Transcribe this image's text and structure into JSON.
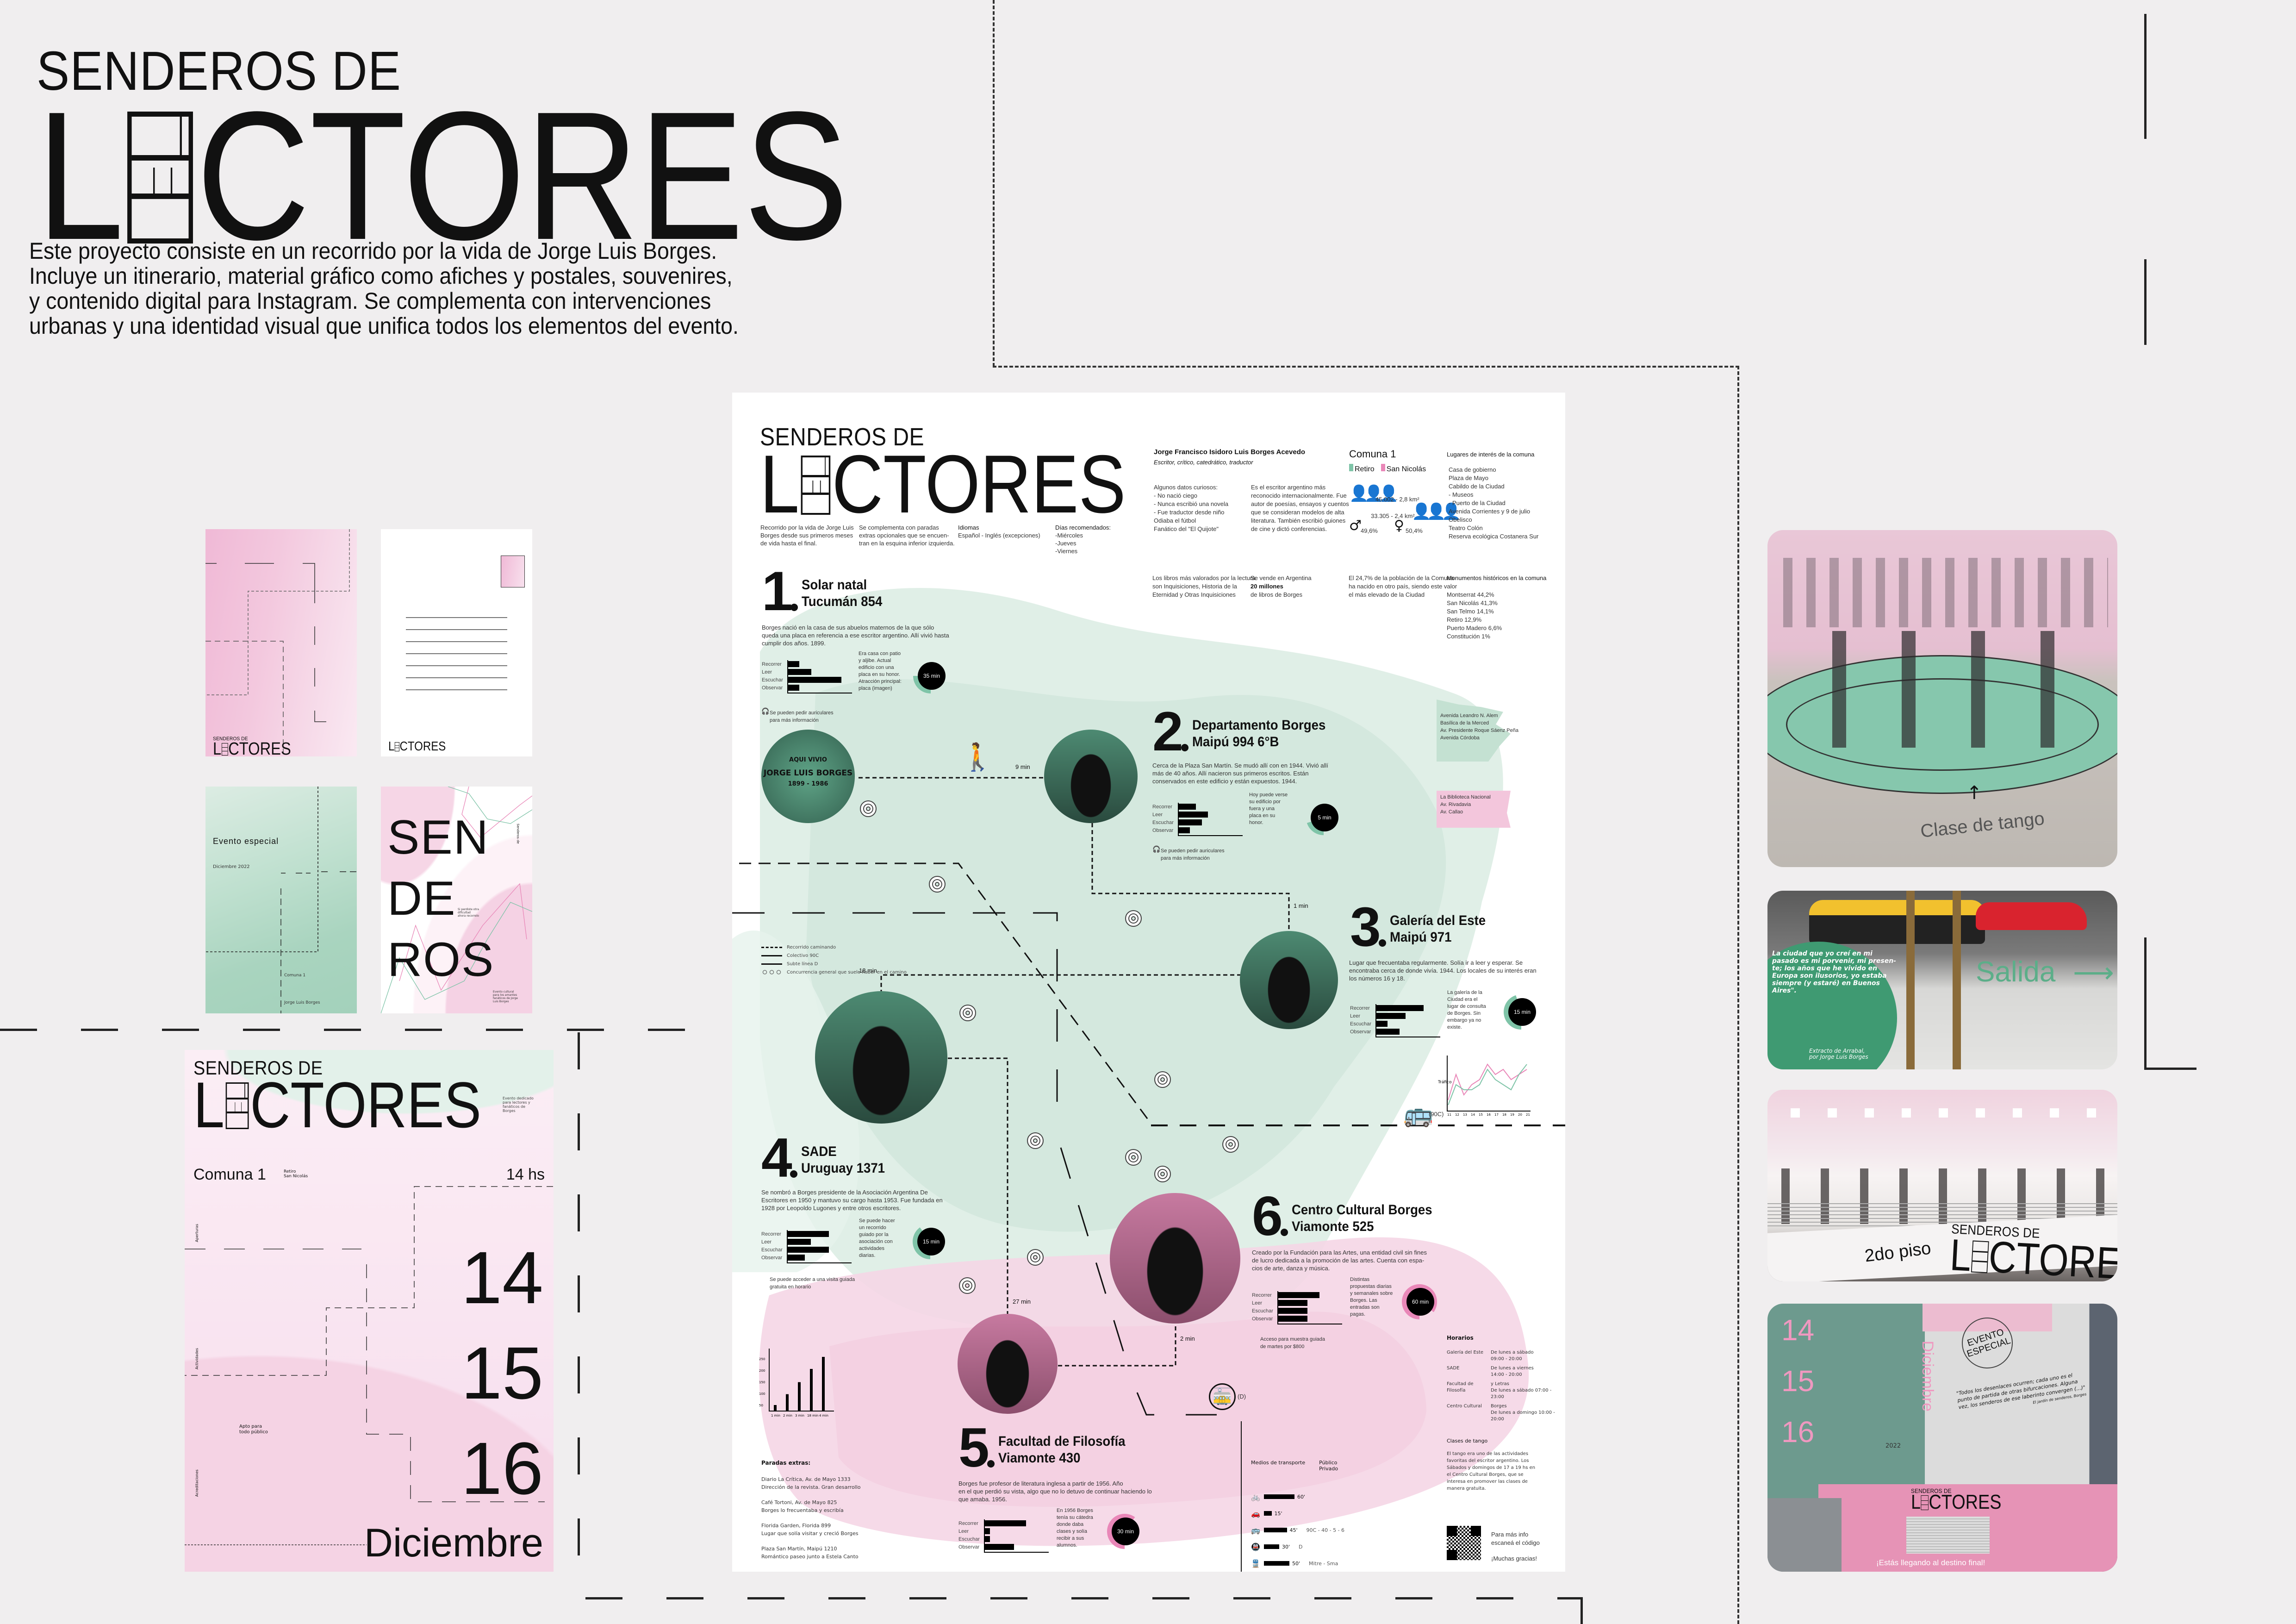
{
  "logo": {
    "prefix": "SENDEROS DE",
    "first_letter": "L",
    "rest": "CTORES"
  },
  "board": {
    "description": [
      "Este proyecto consiste en un recorrido por la vida de Jorge Luis Borges.",
      "Incluye un itinerario, material gráfico como afiches y postales, souvenires,",
      "y contenido digital para Instagram. Se complementa con intervenciones",
      "urbanas y una identidad visual que unifica todos los elementos del evento."
    ]
  },
  "colors": {
    "green": "#7fc4a8",
    "pink": "#e987b8",
    "light_green": "#d6eadf",
    "light_pink": "#f5d6e6",
    "background": "#f0eeef"
  },
  "poster": {
    "intro": [
      [
        "Recorrido por la vida de Jorge Luis",
        "Borges desde sus primeros meses",
        "de vida hasta el final."
      ],
      [
        "Se complementa con paradas",
        "extras opcionales que se encuen-",
        "tran en la esquina inferior izquierda."
      ],
      [
        "Idiomas",
        "Español - Inglés (excepciones)"
      ],
      [
        "Días recomendados:",
        "-Miércoles",
        "-Jueves",
        "-Viernes"
      ]
    ],
    "bio": {
      "name": "Jorge Francisco Isidoro Luis Borges Acevedo",
      "role": "Escritor, crítico, catedrático, traductor",
      "facts": [
        "Algunos datos curiosos:",
        "- No nació ciego",
        "- Nunca escribió una novela",
        "- Fue traductor desde niño",
        "  Odiaba el fútbol",
        "  Fanático del \"El Quijote\""
      ],
      "facts2": [
        "Es el escritor argentino más",
        "reconocido internacionalmente. Fue",
        "autor de poesías, ensayos y cuentos",
        "que se consideran modelos de alta",
        "literatura. También escribió guiones",
        "de cine y dictó conferencias."
      ]
    },
    "comuna": {
      "title": "Comuna 1",
      "areas": [
        {
          "name": "Retiro",
          "color": "#7fc4a8"
        },
        {
          "name": "San Nicolás",
          "color": "#e987b8"
        }
      ],
      "pink_stat": "45.002 - 2,8 km²",
      "green_stat": "33.305 - 2,4 km²",
      "male": "49,6%",
      "female": "50,4%"
    },
    "lugares": {
      "title": "Lugares de interés de la comuna",
      "items": [
        "Casa de gobierno",
        "Plaza de Mayo",
        "Cabildo de la Ciudad",
        "- Museos",
        "- Puerto de la Ciudad",
        "Avenida Corrientes y 9 de julio",
        "Obelisco",
        "Teatro Colón",
        "Reserva ecológica Costanera Sur"
      ]
    },
    "stats": [
      [
        "Los libros más valorados por la lectura",
        "son Inquisiciones, Historia de la",
        "Eternidad y Otras Inquisiciones"
      ],
      [
        "Se vende en Argentina",
        "20 millones",
        "de libros de Borges"
      ],
      [
        "El 24,7% de la población de la Comuna",
        "ha nacido en otro país, siendo este valor",
        "el más elevado de la Ciudad"
      ]
    ],
    "monumentos": {
      "title": "Monumentos históricos en la comuna",
      "items": [
        "Montserrat 44,2%",
        "San Nicolás 41,3%",
        "San Telmo 14,1%",
        "Retiro 12,9%",
        "Puerto Madero 6,6%",
        "Constitución 1%"
      ]
    },
    "bar_labels": [
      "Recorrer",
      "Leer",
      "Escuchar",
      "Observar"
    ],
    "stops": [
      {
        "number": "1",
        "name": "Solar natal",
        "address": "Tucumán 854",
        "desc": [
          "Borges nació en la casa de sus abuelos maternos de la que sólo",
          "queda una placa en referencia a ese escritor argentino. Allí vivió hasta",
          "cumplir dos años. 1899."
        ],
        "bars": [
          2,
          4,
          9,
          2
        ],
        "side": [
          "Era casa con patio",
          "y aljibe. Actual",
          "edificio con una",
          "placa en su honor.",
          "Atracción principal:",
          "placa (imagen)"
        ],
        "gauge": "35 min",
        "gauge_fraction": 0.25,
        "tone": "green",
        "note": [
          "Se pueden pedir auriculares",
          "para más información"
        ],
        "time": "",
        "plaque": [
          "AQUI VIVIO",
          "JORGE LUIS BORGES",
          "1899 - 1986"
        ]
      },
      {
        "number": "2",
        "name": "Departamento Borges",
        "address": "Maipú 994 6°B",
        "desc": [
          "Cerca de la Plaza San Martín. Se mudó allí con en 1944. Vivió allí",
          "más de 40 años. Allí nacieron sus primeros escritos. Están",
          "conservados en este edificio y están expuestos. 1944."
        ],
        "bars": [
          3,
          5,
          4,
          2
        ],
        "side": [
          "Hoy puede verse",
          "su edificio por",
          "fuera y una",
          "placa en su",
          "honor."
        ],
        "gauge": "5 min",
        "gauge_fraction": 0.2,
        "tone": "green",
        "note": [
          "Se pueden pedir auriculares",
          "para más información"
        ],
        "time": "9 min"
      },
      {
        "number": "3",
        "name": "Galería del Este",
        "address": "Maipú 971",
        "desc": [
          "Lugar que frecuentaba regularmente. Solía ir a leer y esperar. Se",
          "encontraba cerca de donde vivía. 1944. Los locales de su interés eran",
          "los números 16 y 18."
        ],
        "bars": [
          8,
          5,
          2,
          4
        ],
        "side": [
          "La galería de la",
          "Ciudad era el",
          "lugar de consulta",
          "de Borges. Sin",
          "embargo ya no",
          "existe."
        ],
        "gauge": "15 min",
        "gauge_fraction": 0.45,
        "tone": "green",
        "time": "1 min"
      },
      {
        "number": "4",
        "name": "SADE",
        "address": "Uruguay 1371",
        "desc": [
          "Se nombró a Borges presidente de la Asociación Argentina De",
          "Escritores en 1950 y mantuvo su cargo hasta 1953. Fue fundada en",
          "1928 por Leopoldo Lugones y entre otros escritores."
        ],
        "bars": [
          7,
          4,
          7,
          3
        ],
        "side": [
          "Se puede hacer",
          "un recorrido",
          "guiado por la",
          "asociación con",
          "actividades",
          "diarias."
        ],
        "gauge": "15 min",
        "gauge_fraction": 0.4,
        "tone": "green",
        "note": [
          "Se puede acceder a una visita guiada",
          "gratuita en horario"
        ],
        "time": "18 min"
      },
      {
        "number": "5",
        "name": "Facultad de Filosofía",
        "address": "Viamonte 430",
        "desc": [
          "Borges fue profesor de literatura inglesa a partir de 1956. Año",
          "en el que perdió su vista, algo que no lo detuvo de continuar haciendo lo",
          "que amaba. 1956."
        ],
        "bars": [
          7,
          1,
          1,
          5
        ],
        "side": [
          "En 1956 Borges",
          "tenía su cátedra",
          "donde daba",
          "clases y solía",
          "recibir a sus",
          "alumnos."
        ],
        "gauge": "30 min",
        "gauge_fraction": 0.6,
        "tone": "pink",
        "time": "27 min"
      },
      {
        "number": "6",
        "name": "Centro Cultural Borges",
        "address": "Viamonte 525",
        "desc": [
          "Creado por la Fundación para las Artes, una entidad civil sin fines",
          "de lucro dedicada a la promoción de las artes. Cuenta con espa-",
          "cios de arte, danza y música."
        ],
        "bars": [
          7,
          5,
          5,
          5
        ],
        "side": [
          "Distintas",
          "propuestas diarias",
          "y semanales sobre",
          "Borges. Las",
          "entradas son",
          "pagas."
        ],
        "gauge": "60 min",
        "gauge_fraction": 0.85,
        "tone": "pink",
        "note": [
          "Acceso para muestra guiada",
          "de martes por $800"
        ],
        "time": "2 min"
      }
    ],
    "legend": [
      "Recorrido caminando",
      "Colectivo 90C",
      "Subte línea D",
      "Concurrencia general que suele haber en el camino"
    ],
    "bus_label": "(90C)",
    "tram_label": "(D)",
    "line_chart": {
      "type": "line",
      "ylabel": "Tráfico",
      "x": [
        11,
        12,
        13,
        14,
        15,
        16,
        17,
        18,
        19,
        20,
        21
      ],
      "series": [
        {
          "name": "pink",
          "color": "#e987b8",
          "values": [
            2,
            7,
            3,
            5,
            6,
            9,
            7,
            8,
            6,
            7,
            8
          ]
        },
        {
          "name": "green",
          "color": "#7fc4a8",
          "values": [
            1,
            5,
            4,
            4,
            5,
            8,
            6,
            5,
            4,
            7,
            9
          ]
        }
      ]
    },
    "column_chart": {
      "type": "bar",
      "categories": [
        "1 min",
        "2 min",
        "3 min",
        "18 min",
        "4 min"
      ],
      "values": [
        10,
        28,
        48,
        70,
        90
      ],
      "yticks": [
        "50",
        "100",
        "150",
        "200",
        "250"
      ]
    },
    "extras": {
      "title": "Paradas extras:",
      "items": [
        [
          "Diario La Crítica, Av. de Mayo 1333",
          "Dirección de la revista. Gran desarrollo"
        ],
        [
          "Café Tortoni, Av. de Mayo 825",
          "Borges lo frecuentaba y escribía"
        ],
        [
          "Florida Garden, Florida 899",
          "Lugar que solía visitar y creció Borges"
        ],
        [
          "Plaza San Martín, Maipú 1210",
          "Romántico paseo junto a Estela Canto"
        ]
      ]
    },
    "transport": {
      "title": "Medios de transporte",
      "public": "Público",
      "private": "Privado",
      "rows": [
        {
          "icon": "bicycle-icon",
          "glyph": "🚲",
          "time": "60'",
          "extra": ""
        },
        {
          "icon": "car-icon",
          "glyph": "🚗",
          "time": "15'",
          "extra": ""
        },
        {
          "icon": "bus-icon",
          "glyph": "🚌",
          "time": "45'",
          "extra": "90C - 40 - 5 - 6"
        },
        {
          "icon": "subway-icon",
          "glyph": "🚇",
          "time": "30'",
          "extra": "D"
        },
        {
          "icon": "train-icon",
          "glyph": "🚆",
          "time": "50'",
          "extra": "Mitre - Sma"
        }
      ]
    },
    "horarios": {
      "title": "Horarios",
      "rows": [
        [
          "Galería del Este",
          "De lunes a sábado",
          "09:00 - 20:00"
        ],
        [
          "SADE",
          "De lunes a viernes",
          "14:00 - 20:00"
        ],
        [
          "Facultad de Filosofía",
          "y Letras",
          "De lunes a sábado 07:00 - 23:00"
        ],
        [
          "Centro Cultural",
          "Borges",
          "De lunes a domingo 10:00 - 20:00"
        ]
      ]
    },
    "tango": {
      "title": "Clases de tango",
      "lines": [
        "El tango era uno de las actividades",
        "favoritas del escritor argentino. Los",
        "Sábados y domingos de 17 a 19 hs en",
        "el Centro Cultural Borges, que se",
        "interesa en promover las clases de",
        "manera gratuita."
      ]
    },
    "qr": {
      "line1": "Para más info",
      "line2": "escaneá el código",
      "thanks": "¡Muchas gracias!"
    }
  },
  "postcards": {
    "card2_logo": "LECTORES",
    "card3": {
      "title": "Evento especial",
      "date": "Diciembre 2022",
      "comuna": "Comuna 1",
      "author": "Jorge Luis Borges"
    },
    "card4": {
      "lines": [
        "SEN",
        "DE",
        "ROS"
      ],
      "note": [
        "Si perdiste otra",
        "dificultad",
        "ahora recorrelo"
      ],
      "side": "Senderos de",
      "footer": [
        "Evento cultural",
        "para los amantes",
        "fanáticos de Jorge",
        "Luis Borges"
      ]
    }
  },
  "big_poster": {
    "note": [
      "Evento dedicado",
      "para lectores y",
      "fanáticos de",
      "Borges"
    ],
    "comuna": "Comuna 1",
    "barrios": [
      "Retiro",
      "San Nicolás"
    ],
    "hour": "14 hs",
    "days": [
      "14",
      "15",
      "16"
    ],
    "month": "Diciembre",
    "audience": [
      "Apto para",
      "todo público"
    ],
    "side_labels": [
      "Aperturas",
      "Actividades",
      "Acreditaciones"
    ]
  },
  "photos": {
    "tango": "Clase de tango",
    "exit": "Salida",
    "quote": [
      "La ciudad que yo creí en mi",
      "pasado es mi porvenir, mi presen-",
      "te; los años que he vivido en",
      "Europa son ilusorios, yo estaba",
      "siempre (y estaré) en Buenos",
      "Aires\"."
    ],
    "quote_source": [
      "Extracto de Arrabal,",
      "por Jorge Luis Borges"
    ],
    "floor": "2do piso",
    "mural_days": [
      "14",
      "15",
      "16"
    ],
    "mural_month": "Diciembre",
    "mural_year": "2022",
    "mural_event": [
      "EVENTO",
      "ESPECIAL"
    ],
    "mural_quote": [
      "\"Todos los desenlaces ocurren; cada uno es el",
      "punto de partida de otras bifurcaciones. Alguna",
      "vez, los senderos de ese laberinto convergen (...)\""
    ],
    "mural_source": "El jardín de senderos, Borges",
    "arrival": "¡Estás llegando al destino final!"
  }
}
